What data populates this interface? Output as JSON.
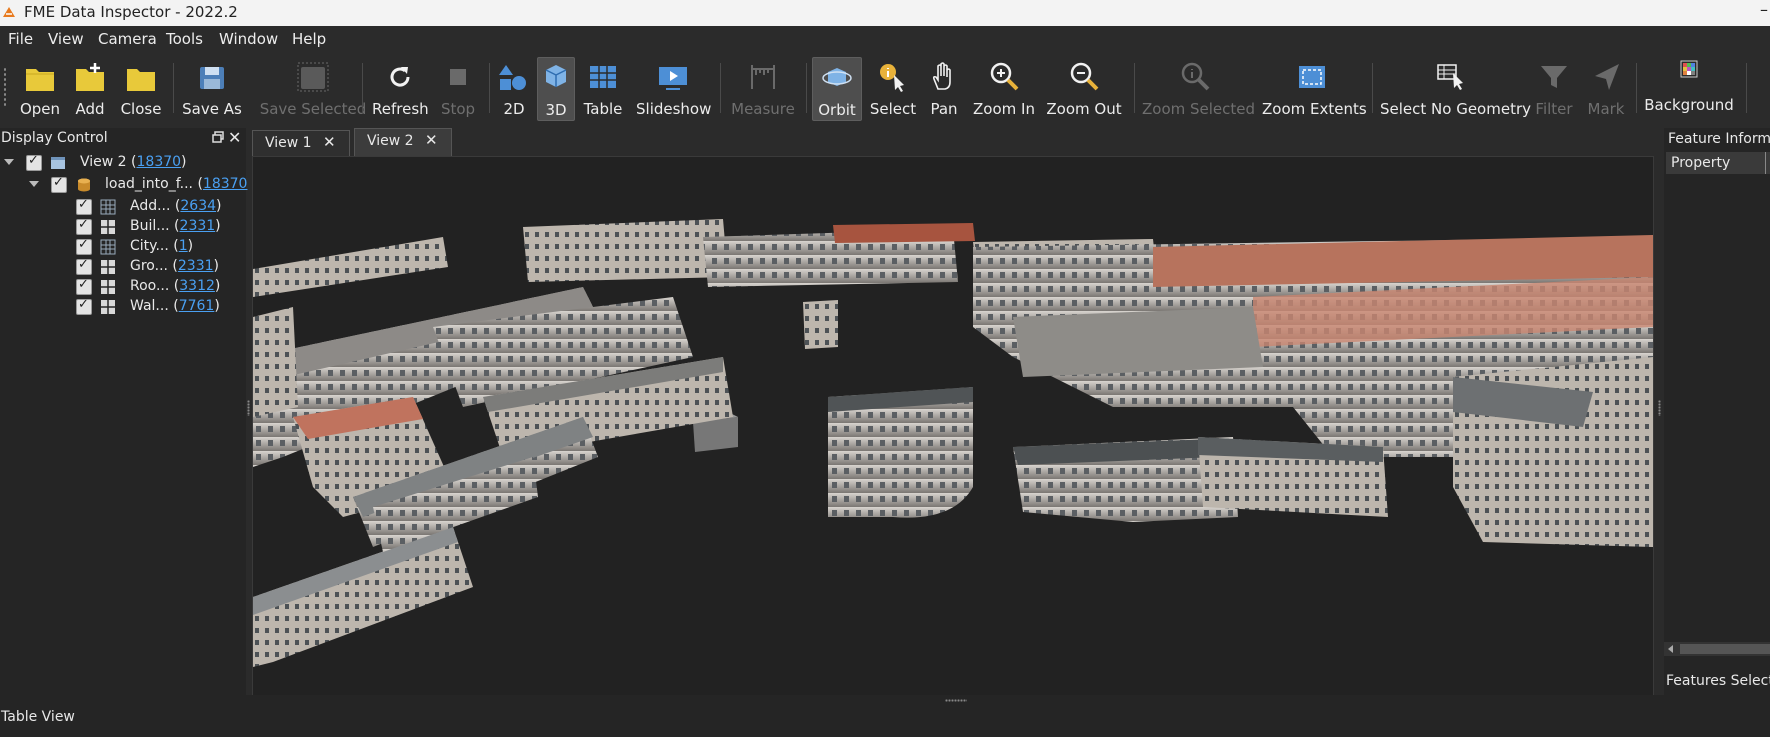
{
  "window": {
    "title": "FME Data Inspector - 2022.2",
    "minimize": "–"
  },
  "menu": [
    "File",
    "View",
    "Camera",
    "Tools",
    "Window",
    "Help"
  ],
  "toolbar": {
    "open": "Open",
    "add": "Add",
    "close": "Close",
    "save_as": "Save As",
    "save_selected": "Save Selected",
    "refresh": "Refresh",
    "stop": "Stop",
    "mode_2d": "2D",
    "mode_3d": "3D",
    "table": "Table",
    "slideshow": "Slideshow",
    "measure": "Measure",
    "orbit": "Orbit",
    "select": "Select",
    "pan": "Pan",
    "zoom_in": "Zoom In",
    "zoom_out": "Zoom Out",
    "zoom_selected": "Zoom Selected",
    "zoom_extents": "Zoom Extents",
    "select_no_geometry": "Select No Geometry",
    "filter": "Filter",
    "mark": "Mark",
    "background": "Background"
  },
  "display_control": {
    "title": "Display Control",
    "root": {
      "label": "View 2 (",
      "count": "18370",
      "close_paren": ")"
    },
    "dataset": {
      "label": "load_into_f... (",
      "count": "18370"
    },
    "layers": [
      {
        "label": "Add... (",
        "count": "2634",
        "close_paren": ")"
      },
      {
        "label": "Buil... (",
        "count": "2331",
        "close_paren": ")"
      },
      {
        "label": "City... (",
        "count": "1",
        "close_paren": ")"
      },
      {
        "label": "Gro... (",
        "count": "2331",
        "close_paren": ")"
      },
      {
        "label": "Roo... (",
        "count": "3312",
        "close_paren": ")"
      },
      {
        "label": "Wal... (",
        "count": "7761",
        "close_paren": ")"
      }
    ]
  },
  "tabs": [
    {
      "label": "View 1",
      "close": "✕"
    },
    {
      "label": "View 2",
      "close": "✕"
    }
  ],
  "feature_info": {
    "title": "Feature Informa",
    "column_property": "Property",
    "footer": "Features Selecte"
  },
  "bottom": {
    "table_view": "Table View"
  },
  "colors": {
    "background": "#2b2b2b",
    "panel": "#252525",
    "viewport": "#222222",
    "link": "#4aa0f2",
    "folder": "#e8c93a"
  }
}
